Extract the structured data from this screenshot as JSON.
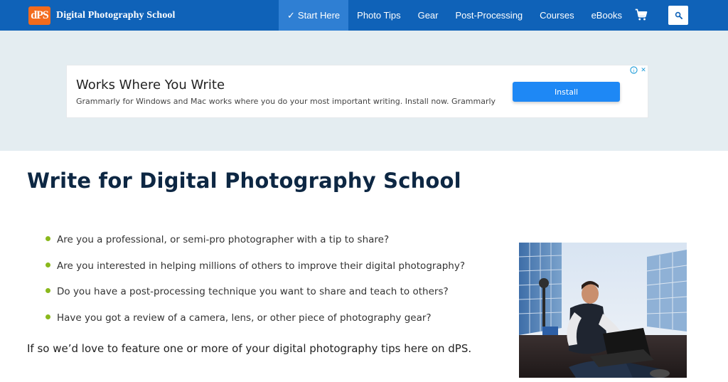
{
  "header": {
    "logo_badge": "dPS",
    "logo_text": "Digital Photography School",
    "nav": [
      {
        "label": "Start Here",
        "active": true
      },
      {
        "label": "Photo Tips",
        "active": false
      },
      {
        "label": "Gear",
        "active": false
      },
      {
        "label": "Post-Processing",
        "active": false
      },
      {
        "label": "Courses",
        "active": false
      },
      {
        "label": "eBooks",
        "active": false
      }
    ],
    "check_mark": "✓",
    "cart_icon": "cart-icon",
    "search_icon": "search-icon"
  },
  "ad": {
    "title": "Works Where You Write",
    "body": "Grammarly for Windows and Mac works where you do your most important writing. Install now. Grammarly",
    "button": "Install",
    "choices_info": "i",
    "choices_close": "✕"
  },
  "main": {
    "title": "Write for Digital Photography School",
    "bullets": [
      "Are you a professional, or semi-pro photographer with a tip to share?",
      "Are you interested in helping millions of others to improve their digital photography?",
      "Do you have a post-processing technique you want to share and teach to others?",
      "Have you got a review of a camera, lens, or other piece of photography gear?"
    ],
    "closing": "If so we’d love to feature one or more of your digital photography tips here on dPS."
  },
  "colors": {
    "header_bg": "#0f62b8",
    "nav_active_bg": "#2f7fd3",
    "logo_badge": "#f26b1d",
    "ad_band_bg": "#e4edf1",
    "install_button": "#1e88f5",
    "title_color": "#0d2743",
    "bullet_dot": "#8ab81c"
  }
}
